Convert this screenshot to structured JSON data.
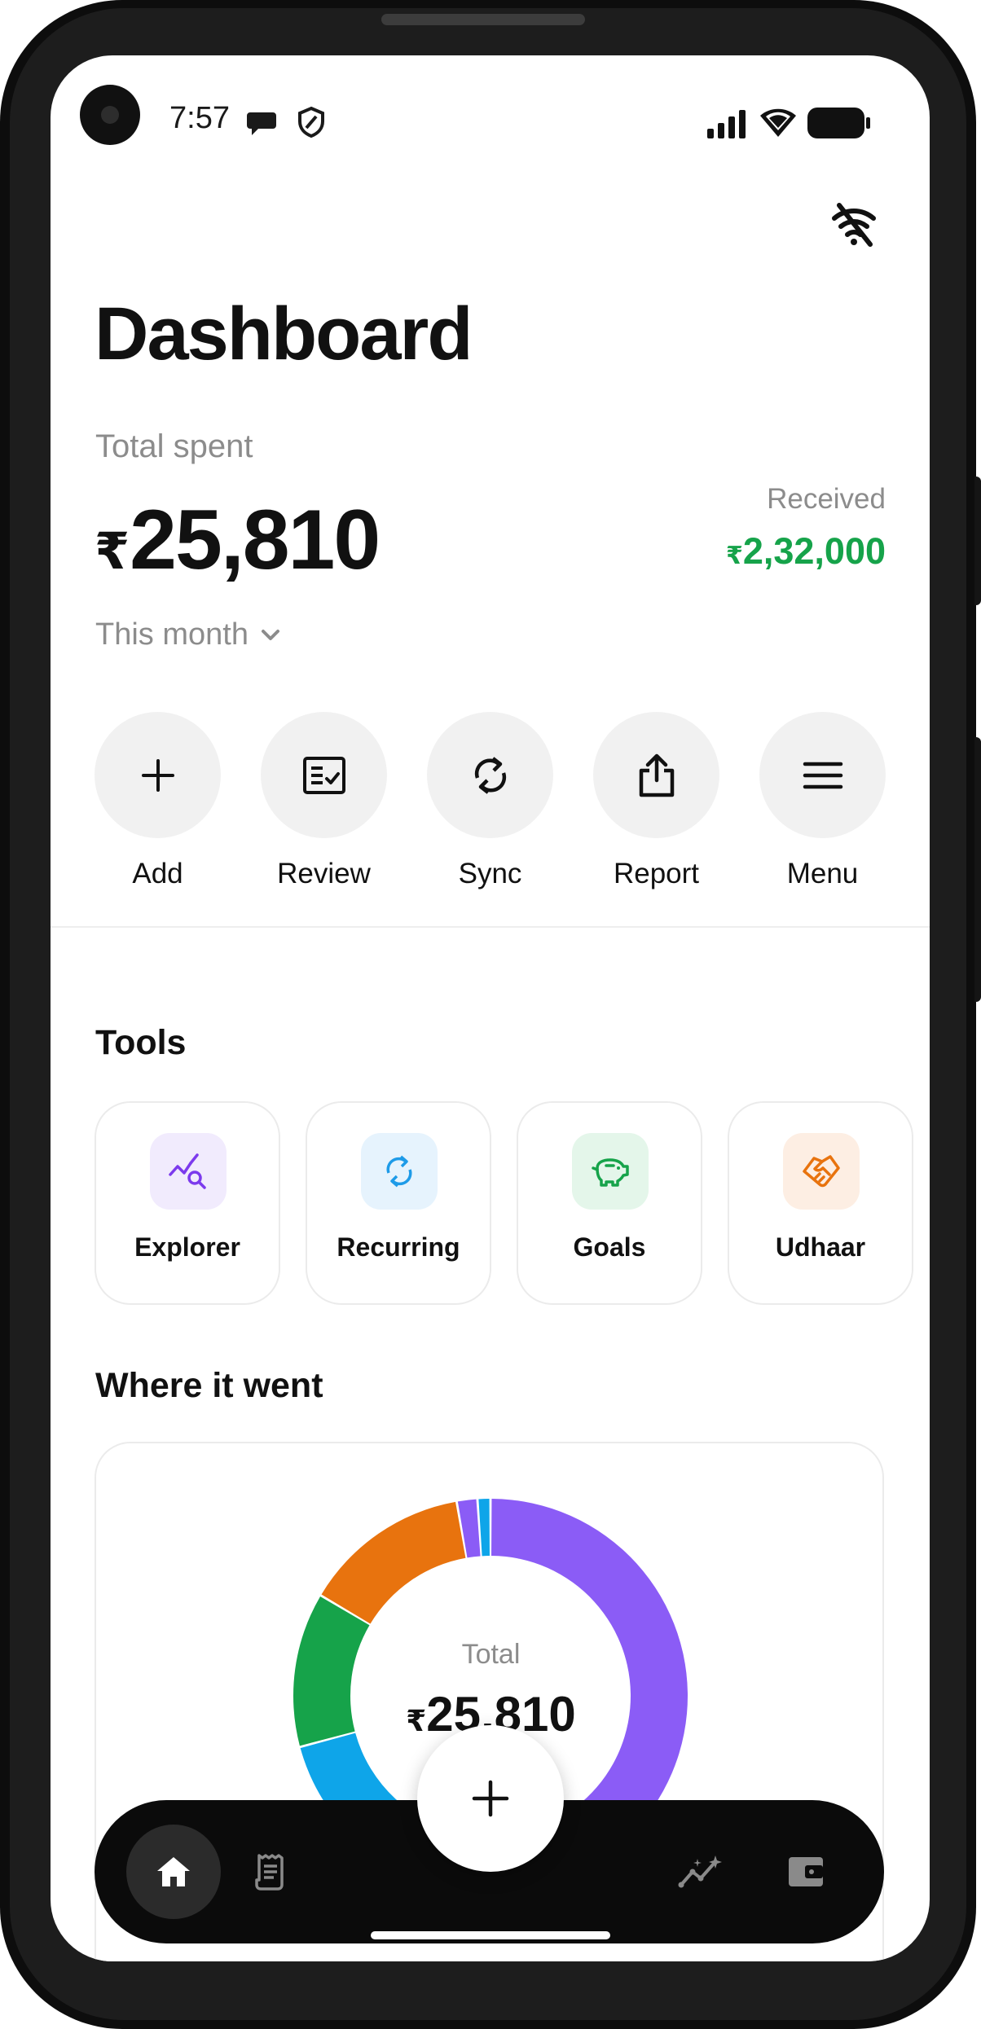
{
  "status_bar": {
    "time": "7:57"
  },
  "header": {
    "title": "Dashboard"
  },
  "summary": {
    "total_spent_label": "Total spent",
    "currency": "₹",
    "total_spent_value": "25,810",
    "received_label": "Received",
    "received_value": "2,32,000",
    "period_label": "This month"
  },
  "actions": [
    {
      "label": "Add",
      "icon": "plus-icon"
    },
    {
      "label": "Review",
      "icon": "review-checklist-icon"
    },
    {
      "label": "Sync",
      "icon": "sync-icon"
    },
    {
      "label": "Report",
      "icon": "share-upload-icon"
    },
    {
      "label": "Menu",
      "icon": "menu-icon"
    }
  ],
  "tools": {
    "title": "Tools",
    "items": [
      {
        "label": "Explorer",
        "icon": "chart-search-icon",
        "color": "#7c3aed",
        "bg": "#f1ebfd"
      },
      {
        "label": "Recurring",
        "icon": "repeat-icon",
        "color": "#1e9be8",
        "bg": "#e6f3fd"
      },
      {
        "label": "Goals",
        "icon": "piggy-bank-icon",
        "color": "#16a34a",
        "bg": "#e4f6ea"
      },
      {
        "label": "Udhaar",
        "icon": "handshake-icon",
        "color": "#e8730e",
        "bg": "#fdeee3"
      }
    ]
  },
  "breakdown": {
    "title": "Where it went",
    "center_label": "Total",
    "center_value": "25,810"
  },
  "chart_data": {
    "type": "pie",
    "title": "",
    "total": 25810,
    "slices": [
      {
        "color": "#8b5cf6",
        "share": 0.5
      },
      {
        "color": "#0ea5e9",
        "share": 0.17
      },
      {
        "color": "#16a34a",
        "share": 0.12
      },
      {
        "color": "#e8730e",
        "share": 0.13
      },
      {
        "color": "#8b5cf6",
        "share": 0.016
      },
      {
        "color": "#0ea5e9",
        "share": 0.01
      }
    ]
  },
  "bottom_nav": {
    "items": [
      {
        "icon": "home-icon",
        "active": true
      },
      {
        "icon": "receipt-icon",
        "active": false
      },
      {
        "icon": "insights-sparkle-icon",
        "active": false
      },
      {
        "icon": "wallet-icon",
        "active": false
      }
    ],
    "fab_icon": "plus-icon"
  },
  "colors": {
    "accent_green": "#16a34a",
    "text_primary": "#111111",
    "text_muted": "#8c8c8c"
  }
}
